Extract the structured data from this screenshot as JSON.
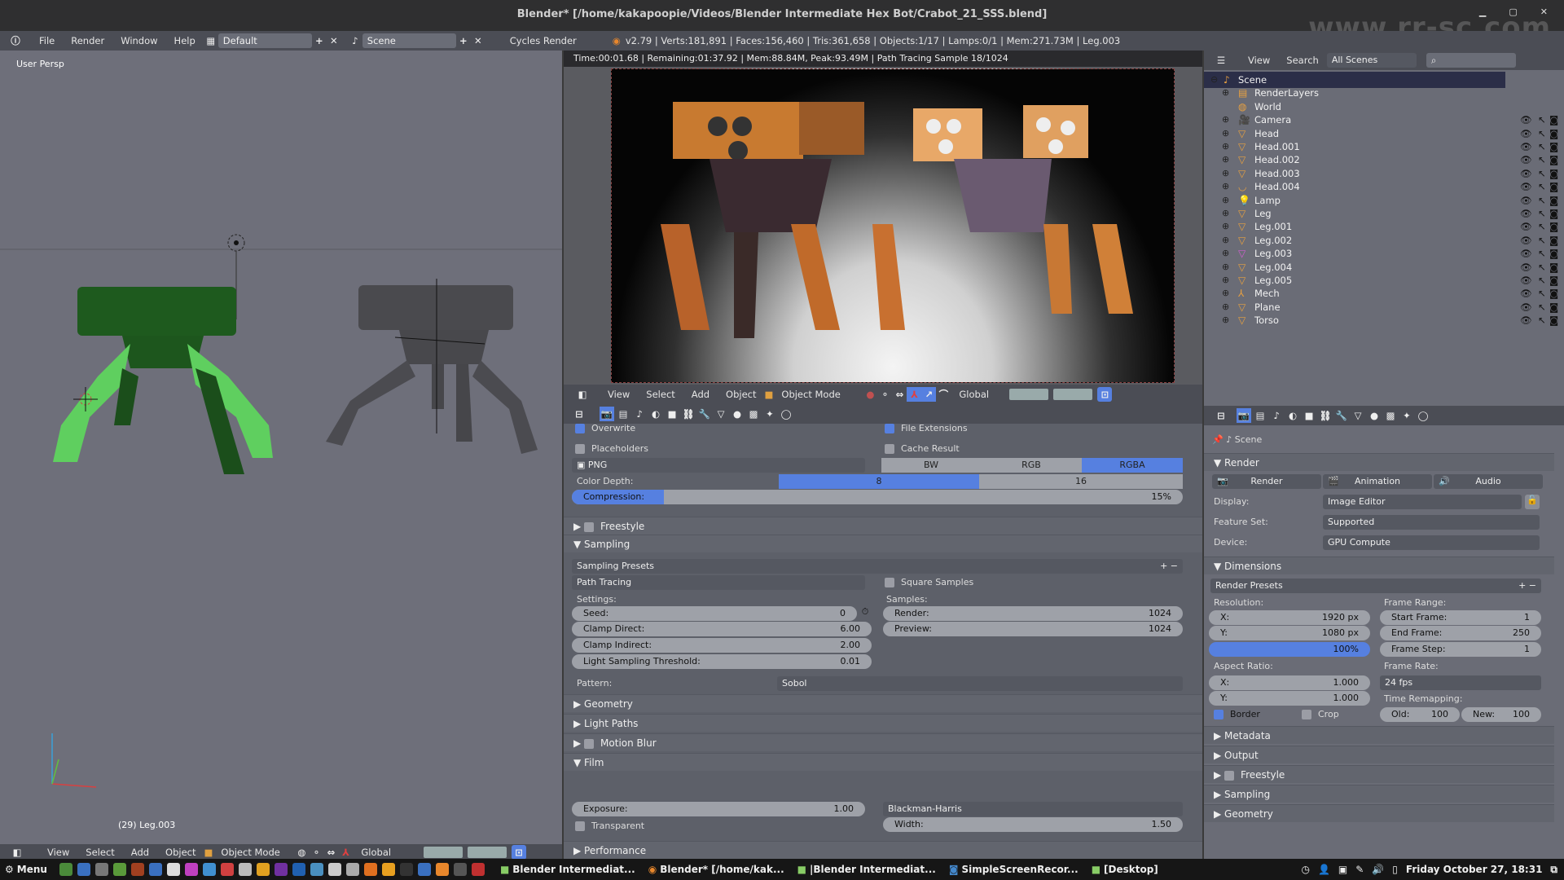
{
  "window": {
    "title": "Blender* [/home/kakapoopie/Videos/Blender Intermediate Hex Bot/Crabot_21_SSS.blend]",
    "controls": [
      "minimize",
      "maximize",
      "close"
    ],
    "watermark": "www.rr-sc.com"
  },
  "infobar": {
    "menus": [
      "File",
      "Render",
      "Window",
      "Help"
    ],
    "layout": "Default",
    "scene": "Scene",
    "engine": "Cycles Render",
    "stats": "v2.79 | Verts:181,891 | Faces:156,460 | Tris:361,658 | Objects:1/17 | Lamps:0/1 | Mem:271.73M | Leg.003"
  },
  "viewport": {
    "label": "User Persp",
    "active_object": "(29) Leg.003",
    "header": {
      "menus": [
        "View",
        "Select",
        "Add",
        "Object"
      ],
      "mode": "Object Mode",
      "orientation": "Global"
    }
  },
  "render_view": {
    "status": "Time:00:01.68 | Remaining:01:37.92 | Mem:88.84M, Peak:93.49M | Path Tracing Sample 18/1024",
    "header": {
      "menus": [
        "View",
        "Select",
        "Add",
        "Object"
      ],
      "mode": "Object Mode",
      "orientation": "Global"
    }
  },
  "props_mid": {
    "overwrite": "Overwrite",
    "file_extensions": "File Extensions",
    "placeholders": "Placeholders",
    "cache_result": "Cache Result",
    "format": "PNG",
    "color_modes": [
      "BW",
      "RGB",
      "RGBA"
    ],
    "color_mode_active": "RGBA",
    "color_depth_label": "Color Depth:",
    "color_depths": [
      "8",
      "16"
    ],
    "color_depth_active": "8",
    "compression_label": "Compression:",
    "compression": "15%",
    "compression_fraction": 0.15,
    "freestyle": "Freestyle",
    "sampling": "Sampling",
    "sampling_presets": "Sampling Presets",
    "integrator": "Path Tracing",
    "square_samples": "Square Samples",
    "settings_label": "Settings:",
    "samples_label": "Samples:",
    "seed": {
      "label": "Seed:",
      "value": "0"
    },
    "clamp_direct": {
      "label": "Clamp Direct:",
      "value": "6.00"
    },
    "clamp_indirect": {
      "label": "Clamp Indirect:",
      "value": "2.00"
    },
    "light_threshold": {
      "label": "Light Sampling Threshold:",
      "value": "0.01"
    },
    "render_samples": {
      "label": "Render:",
      "value": "1024"
    },
    "preview_samples": {
      "label": "Preview:",
      "value": "1024"
    },
    "pattern_label": "Pattern:",
    "pattern": "Sobol",
    "geometry": "Geometry",
    "light_paths": "Light Paths",
    "motion_blur": "Motion Blur",
    "film": "Film",
    "exposure": {
      "label": "Exposure:",
      "value": "1.00"
    },
    "filter": "Blackman-Harris",
    "width": {
      "label": "Width:",
      "value": "1.50"
    },
    "transparent": "Transparent",
    "performance": "Performance"
  },
  "outliner": {
    "menus": [
      "View",
      "Search"
    ],
    "filter": "All Scenes",
    "items": [
      {
        "name": "Scene",
        "icon": "scene-icon",
        "level": 0
      },
      {
        "name": "RenderLayers",
        "icon": "renderlayers-icon",
        "level": 1
      },
      {
        "name": "World",
        "icon": "world-icon",
        "level": 1
      },
      {
        "name": "Camera",
        "icon": "camera-icon",
        "level": 1
      },
      {
        "name": "Head",
        "icon": "mesh-icon",
        "level": 1
      },
      {
        "name": "Head.001",
        "icon": "mesh-icon",
        "level": 1
      },
      {
        "name": "Head.002",
        "icon": "mesh-icon",
        "level": 1
      },
      {
        "name": "Head.003",
        "icon": "mesh-icon",
        "level": 1
      },
      {
        "name": "Head.004",
        "icon": "curve-icon",
        "level": 1
      },
      {
        "name": "Lamp",
        "icon": "lamp-icon",
        "level": 1
      },
      {
        "name": "Leg",
        "icon": "mesh-icon",
        "level": 1
      },
      {
        "name": "Leg.001",
        "icon": "mesh-icon",
        "level": 1
      },
      {
        "name": "Leg.002",
        "icon": "mesh-icon",
        "level": 1
      },
      {
        "name": "Leg.003",
        "icon": "mesh-icon",
        "level": 1
      },
      {
        "name": "Leg.004",
        "icon": "mesh-icon",
        "level": 1
      },
      {
        "name": "Leg.005",
        "icon": "mesh-icon",
        "level": 1
      },
      {
        "name": "Mech",
        "icon": "empty-icon",
        "level": 1
      },
      {
        "name": "Plane",
        "icon": "mesh-icon",
        "level": 1
      },
      {
        "name": "Torso",
        "icon": "mesh-icon",
        "level": 1
      }
    ]
  },
  "props_right": {
    "context": "Scene",
    "render": "Render",
    "btn_render": "Render",
    "btn_animation": "Animation",
    "btn_audio": "Audio",
    "display_label": "Display:",
    "display": "Image Editor",
    "feature_label": "Feature Set:",
    "feature": "Supported",
    "device_label": "Device:",
    "device": "GPU Compute",
    "dimensions": "Dimensions",
    "render_presets": "Render Presets",
    "resolution_label": "Resolution:",
    "res_x": {
      "label": "X:",
      "value": "1920 px"
    },
    "res_y": {
      "label": "Y:",
      "value": "1080 px"
    },
    "res_pct": "100%",
    "frame_range_label": "Frame Range:",
    "start_frame": {
      "label": "Start Frame:",
      "value": "1"
    },
    "end_frame": {
      "label": "End Frame:",
      "value": "250"
    },
    "frame_step": {
      "label": "Frame Step:",
      "value": "1"
    },
    "aspect_label": "Aspect Ratio:",
    "aspect_x": {
      "label": "X:",
      "value": "1.000"
    },
    "aspect_y": {
      "label": "Y:",
      "value": "1.000"
    },
    "frame_rate_label": "Frame Rate:",
    "frame_rate": "24 fps",
    "time_remap_label": "Time Remapping:",
    "old": {
      "label": "Old:",
      "value": "100"
    },
    "new": {
      "label": "New:",
      "value": "100"
    },
    "border": "Border",
    "crop": "Crop",
    "collapsed": [
      "Metadata",
      "Output",
      "Freestyle",
      "Sampling",
      "Geometry"
    ]
  },
  "taskbar": {
    "menu": "Menu",
    "windows": [
      "Blender Intermediat...",
      "Blender* [/home/kak...",
      "|Blender Intermediat...",
      "SimpleScreenRecor...",
      "[Desktop]"
    ],
    "clock": "Friday October 27, 18:31"
  }
}
